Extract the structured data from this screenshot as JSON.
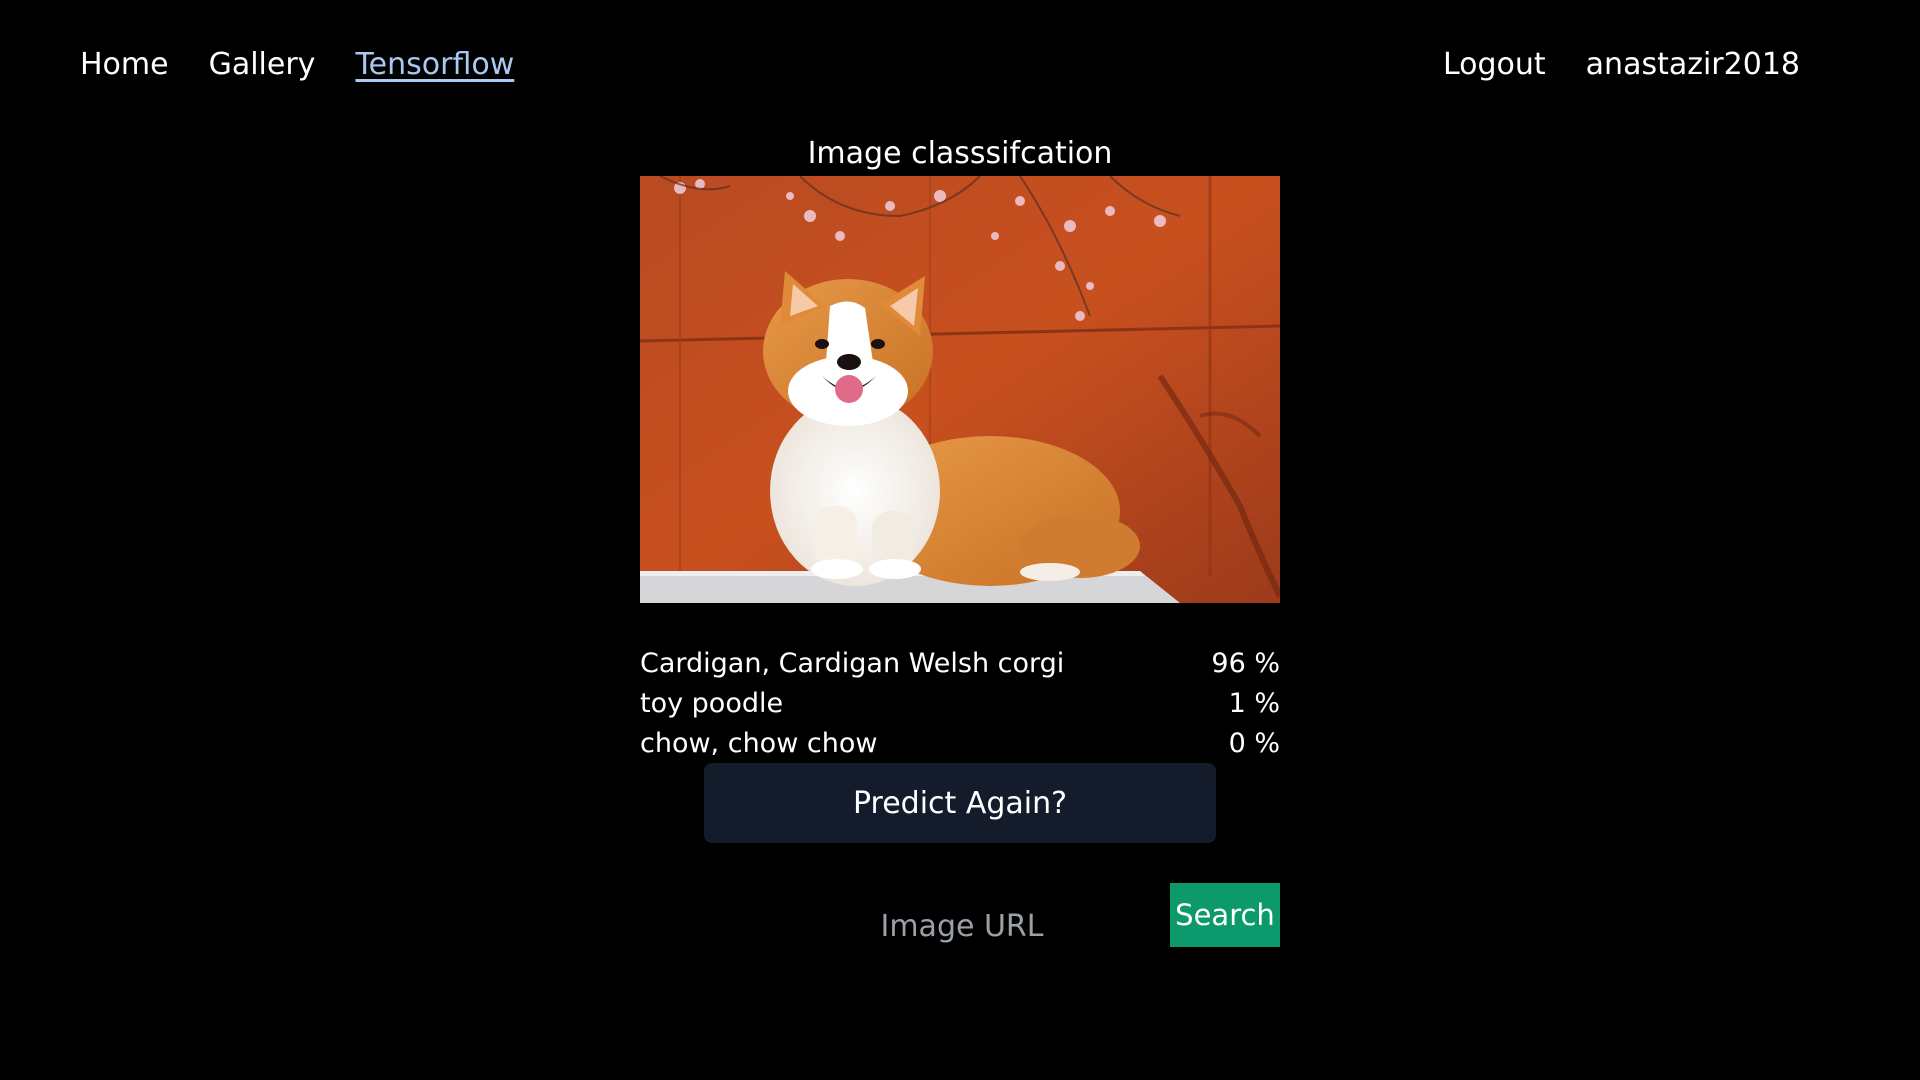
{
  "nav": {
    "left": [
      {
        "label": "Home",
        "active": false
      },
      {
        "label": "Gallery",
        "active": false
      },
      {
        "label": "Tensorflow",
        "active": true
      }
    ],
    "right": [
      {
        "label": "Logout"
      },
      {
        "label": "anastazir2018"
      }
    ]
  },
  "page": {
    "title": "Image classsifcation"
  },
  "photo": {
    "subject": "corgi-photo"
  },
  "results": [
    {
      "label": "Cardigan, Cardigan Welsh corgi",
      "percent": "96 %"
    },
    {
      "label": "toy poodle",
      "percent": "1 %"
    },
    {
      "label": "chow, chow chow",
      "percent": "0 %"
    }
  ],
  "actions": {
    "predict_label": "Predict Again?",
    "url_placeholder": "Image URL",
    "search_label": "Search"
  },
  "colors": {
    "background": "#000000",
    "active_link": "#a9c8f2",
    "predict_button": "#141b2b",
    "search_button": "#0c9a6c"
  }
}
